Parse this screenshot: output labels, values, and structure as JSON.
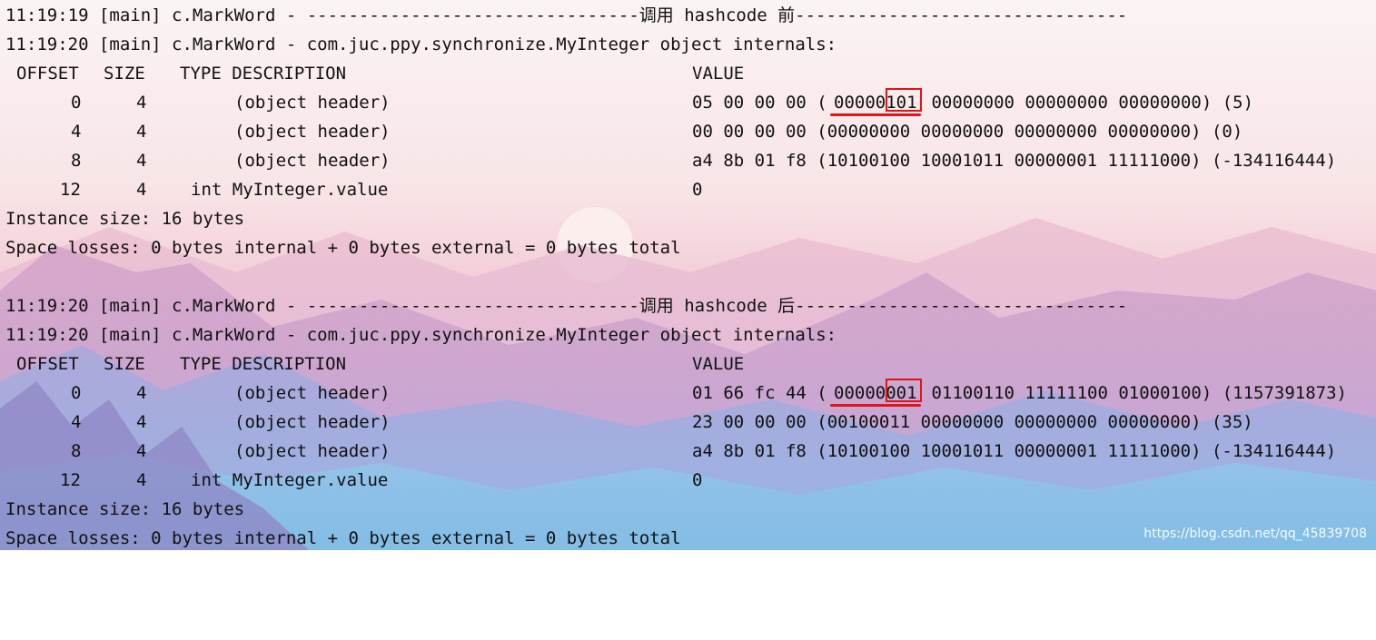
{
  "colors": {
    "text": "#111111",
    "highlight": "#e0151a",
    "watermark": "#ffffff"
  },
  "block1": {
    "header": "11:19:19 [main] c.MarkWord - --------------------------------调用 hashcode 前--------------------------------",
    "internals": "11:19:20 [main] c.MarkWord - com.juc.ppy.synchronize.MyInteger object internals:",
    "col_offset": "OFFSET",
    "col_size": "SIZE",
    "col_type": "TYPE DESCRIPTION",
    "col_value": "VALUE",
    "rows": [
      {
        "offset": "0",
        "size": "4",
        "type": "(object header)",
        "value_pre": "05 00 00 00 (",
        "value_hl": "00000101",
        "value_post": " 00000000 00000000 00000000) (5)"
      },
      {
        "offset": "4",
        "size": "4",
        "type": "(object header)",
        "value": "00 00 00 00 (00000000 00000000 00000000 00000000) (0)"
      },
      {
        "offset": "8",
        "size": "4",
        "type": "(object header)",
        "value": "a4 8b 01 f8 (10100100 10001011 00000001 11111000) (-134116444)"
      },
      {
        "offset": "12",
        "size": "4",
        "type": "int MyInteger.value",
        "value": "0"
      }
    ],
    "instance_size": "Instance size: 16 bytes",
    "space_losses": "Space losses: 0 bytes internal + 0 bytes external = 0 bytes total"
  },
  "block2": {
    "header": "11:19:20 [main] c.MarkWord - --------------------------------调用 hashcode 后--------------------------------",
    "internals": "11:19:20 [main] c.MarkWord - com.juc.ppy.synchronize.MyInteger object internals:",
    "col_offset": "OFFSET",
    "col_size": "SIZE",
    "col_type": "TYPE DESCRIPTION",
    "col_value": "VALUE",
    "rows": [
      {
        "offset": "0",
        "size": "4",
        "type": "(object header)",
        "value_pre": "01 66 fc 44 (",
        "value_hl": "00000001",
        "value_post": " 01100110 11111100 01000100) (1157391873)"
      },
      {
        "offset": "4",
        "size": "4",
        "type": "(object header)",
        "value": "23 00 00 00 (00100011 00000000 00000000 00000000) (35)"
      },
      {
        "offset": "8",
        "size": "4",
        "type": "(object header)",
        "value": "a4 8b 01 f8 (10100100 10001011 00000001 11111000) (-134116444)"
      },
      {
        "offset": "12",
        "size": "4",
        "type": "int MyInteger.value",
        "value": "0"
      }
    ],
    "instance_size": "Instance size: 16 bytes",
    "space_losses": "Space losses: 0 bytes internal + 0 bytes external = 0 bytes total"
  },
  "watermark": "https://blog.csdn.net/qq_45839708"
}
